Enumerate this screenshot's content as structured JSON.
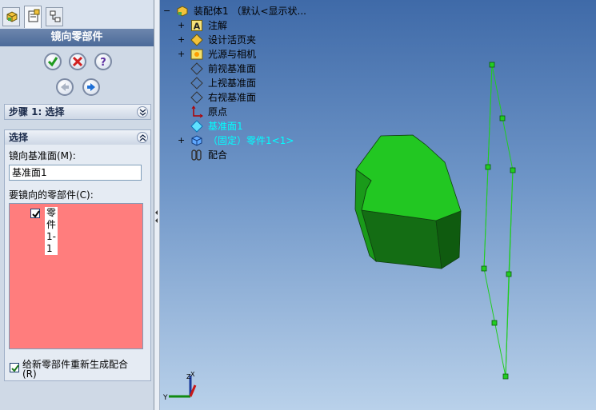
{
  "property_manager": {
    "title": "镜向零部件",
    "step_section": {
      "title": "步骤 1: 选择"
    },
    "select_section": {
      "title": "选择",
      "mirror_plane_label": "镜向基准面(M):",
      "mirror_plane_value": "基准面1",
      "components_label": "要镜向的零部件(C):",
      "components": [
        {
          "name": "零件1-1",
          "checked": true
        }
      ],
      "regenerate_mates_label": "给新零部件重新生成配合",
      "regenerate_mates_accel": "(R)",
      "regenerate_mates_checked": true,
      "list_highlight_color": "#ff7d7d"
    }
  },
  "feature_tree": {
    "root": "装配体1 （默认<显示状...",
    "items": [
      {
        "label": "注解",
        "expander": "+"
      },
      {
        "label": "设计活页夹",
        "expander": "+"
      },
      {
        "label": "光源与相机",
        "expander": "+"
      },
      {
        "label": "前视基准面"
      },
      {
        "label": "上视基准面"
      },
      {
        "label": "右视基准面"
      },
      {
        "label": "原点"
      },
      {
        "label": "基准面1",
        "highlighted": true,
        "color": "#00ffff"
      },
      {
        "label": "（固定）零件1<1>",
        "expander": "+",
        "highlighted": true,
        "color": "#00ffff"
      },
      {
        "label": "配合"
      }
    ]
  },
  "triad": {
    "x": "X",
    "y": "Y",
    "z": "Z"
  },
  "colors": {
    "part_green": "#1fbf1f",
    "plane_outline": "#22cc22",
    "title_bar": "#4b6a99"
  }
}
